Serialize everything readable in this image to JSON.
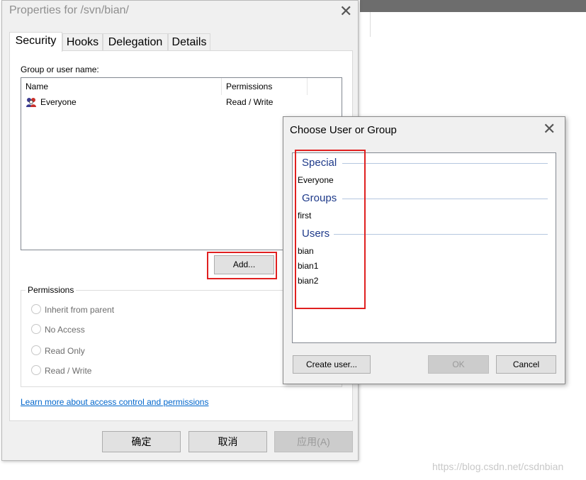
{
  "properties_dialog": {
    "title": "Properties for /svn/bian/",
    "close_glyph": "✕",
    "tabs": [
      "Security",
      "Hooks",
      "Delegation",
      "Details"
    ],
    "active_tab": "Security",
    "group_label": "Group or user name:",
    "columns": [
      "Name",
      "Permissions"
    ],
    "rows": [
      {
        "name": "Everyone",
        "permission": "Read / Write",
        "icon": "users-group-icon"
      }
    ],
    "add_button": "Add...",
    "permissions_group": {
      "title": "Permissions",
      "options": [
        "Inherit from parent",
        "No Access",
        "Read Only",
        "Read / Write"
      ]
    },
    "link_text": "Learn more about access control and permissions",
    "buttons": {
      "ok": "确定",
      "cancel": "取消",
      "apply": "应用(A)"
    }
  },
  "choose_dialog": {
    "title": "Choose User or Group",
    "close_glyph": "✕",
    "groups": [
      {
        "heading": "Special",
        "items": [
          "Everyone"
        ]
      },
      {
        "heading": "Groups",
        "items": [
          "first"
        ]
      },
      {
        "heading": "Users",
        "items": [
          "bian",
          "bian1",
          "bian2"
        ]
      }
    ],
    "create_user_button": "Create user...",
    "ok_button": "OK",
    "cancel_button": "Cancel"
  },
  "watermark": "https://blog.csdn.net/csdnbian",
  "colors": {
    "highlight": "#e02020",
    "group_heading": "#1e3a8a",
    "link": "#0066cc"
  }
}
